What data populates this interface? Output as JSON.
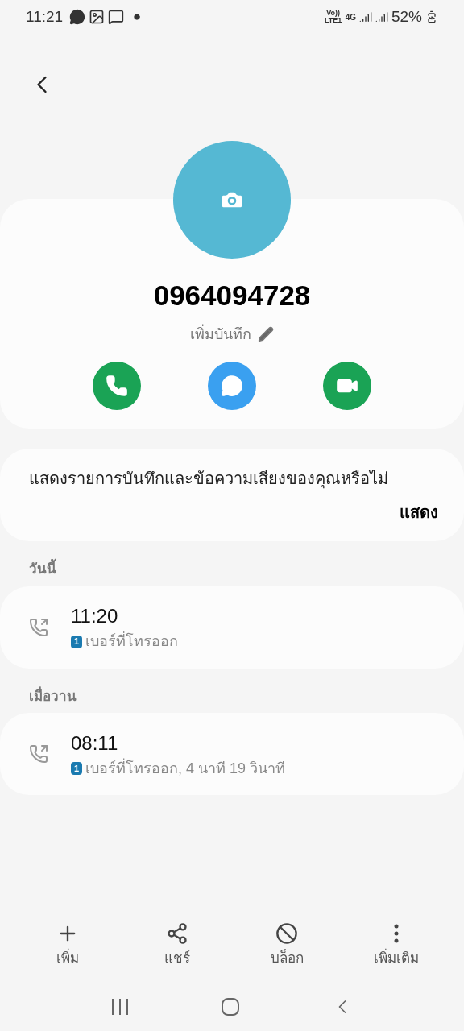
{
  "status_bar": {
    "time": "11:21",
    "network": "Vo)) LTE1",
    "data": "4G",
    "battery": "52%"
  },
  "contact": {
    "number": "0964094728",
    "add_note": "เพิ่มบันทึก"
  },
  "actions": [
    {
      "kind": "call"
    },
    {
      "kind": "message"
    },
    {
      "kind": "video"
    }
  ],
  "prompt": {
    "text": "แสดงรายการบันทึกและข้อความเสียงของคุณหรือไม่",
    "button": "แสดง"
  },
  "log": [
    {
      "heading": "วันนี้",
      "calls": [
        {
          "time": "11:20",
          "sim": "1",
          "detail": "เบอร์ที่โทรออก"
        }
      ]
    },
    {
      "heading": "เมื่อวาน",
      "calls": [
        {
          "time": "08:11",
          "sim": "1",
          "detail": "เบอร์ที่โทรออก, 4 นาที 19 วินาที"
        }
      ]
    }
  ],
  "bottom_bar": [
    {
      "kind": "add",
      "label": "เพิ่ม"
    },
    {
      "kind": "share",
      "label": "แชร์"
    },
    {
      "kind": "block",
      "label": "บล็อก"
    },
    {
      "kind": "more",
      "label": "เพิ่มเติม"
    }
  ]
}
